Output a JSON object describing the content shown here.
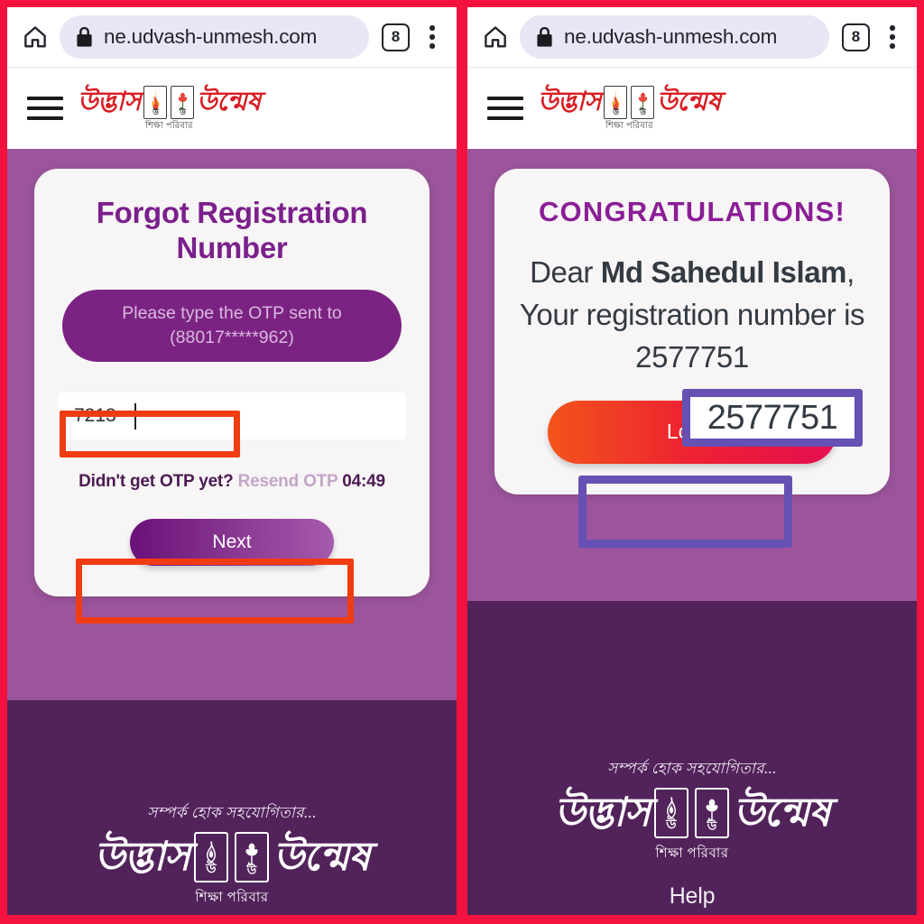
{
  "theme": {
    "frame_red": "#F5123E",
    "page_purple": "#9C559C",
    "footer_purple": "#52235B",
    "brand_purple": "#7B1F8C",
    "banner_purple": "#7B2382",
    "annotation_red": "#F03C12",
    "annotation_purple": "#6650B4",
    "logo_red": "#D81E24"
  },
  "browser": {
    "home_icon": "home-icon",
    "lock_icon": "lock-icon",
    "url": "ne.udvash-unmesh.com",
    "tab_count": "8",
    "menu_icon": "kebab-menu-icon"
  },
  "site_header": {
    "menu_icon": "hamburger-icon",
    "logo_left_word": "উদ্ভাস",
    "logo_right_word": "উন্মেষ",
    "logo_subtitle": "শিক্ষা পরিবার",
    "flame_icon": "flame-icon",
    "tulip_icon": "tulip-icon"
  },
  "left_panel": {
    "card_title": "Forgot Registration Number",
    "otp_banner_line1": "Please type the OTP sent to",
    "otp_banner_line2": "(88017*****962)",
    "otp_value": "7213",
    "otp_placeholder": "",
    "resend_prompt": "Didn't get OTP yet?",
    "resend_link": "Resend OTP",
    "resend_timer": "04:49",
    "next_label": "Next"
  },
  "right_panel": {
    "congrats_title": "CONGRATULATIONS!",
    "greeting_prefix": "Dear ",
    "user_name": "Md Sahedul Islam",
    "greeting_comma": ",",
    "registration_sentence": "Your registration number is ",
    "registration_number": "2577751",
    "login_label": "Login",
    "help_label": "Help"
  },
  "footer": {
    "tagline": "সম্পর্ক হোক সহযোগিতার...",
    "logo_left_word": "উদ্ভাস",
    "logo_right_word": "উন্মেষ",
    "logo_subtitle": "শিক্ষা পরিবার",
    "flame_icon": "flame-icon",
    "tulip_icon": "tulip-icon"
  },
  "annotations": [
    {
      "name": "otp-input-highlight",
      "color": "#F03C12"
    },
    {
      "name": "next-button-highlight",
      "color": "#F03C12"
    },
    {
      "name": "registration-number-highlight",
      "color": "#6650B4"
    },
    {
      "name": "login-button-highlight",
      "color": "#6650B4"
    }
  ]
}
